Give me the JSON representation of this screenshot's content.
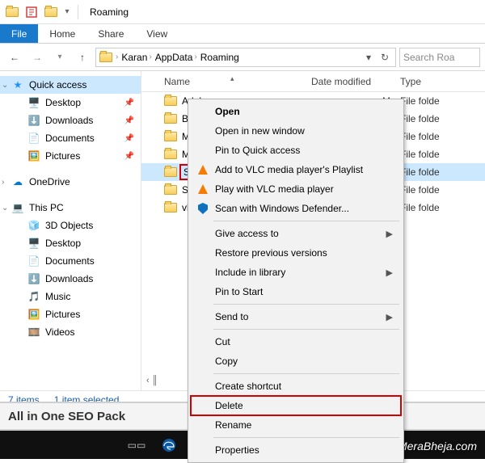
{
  "window": {
    "title": "Roaming"
  },
  "ribbon": {
    "file": "File",
    "home": "Home",
    "share": "Share",
    "view": "View"
  },
  "breadcrumb": {
    "items": [
      "Karan",
      "AppData",
      "Roaming"
    ]
  },
  "search": {
    "placeholder": "Search Roa"
  },
  "columns": {
    "name": "Name",
    "date": "Date modified",
    "type": "Type"
  },
  "navpane": {
    "quick_access": "Quick access",
    "quick_items": [
      {
        "label": "Desktop"
      },
      {
        "label": "Downloads"
      },
      {
        "label": "Documents"
      },
      {
        "label": "Pictures"
      }
    ],
    "onedrive": "OneDrive",
    "this_pc": "This PC",
    "pc_items": [
      {
        "label": "3D Objects"
      },
      {
        "label": "Desktop"
      },
      {
        "label": "Documents"
      },
      {
        "label": "Downloads"
      },
      {
        "label": "Music"
      },
      {
        "label": "Pictures"
      },
      {
        "label": "Videos"
      }
    ]
  },
  "files": [
    {
      "name": "Adobe",
      "date": "M",
      "type": "File folde"
    },
    {
      "name": "BID",
      "date": "M",
      "type": "File folde"
    },
    {
      "name": "Microso",
      "date": "M",
      "type": "File folde"
    },
    {
      "name": "Mozilla",
      "date": "PM",
      "type": "File folde"
    },
    {
      "name": "Skype",
      "date": "M",
      "type": "File folde",
      "selected": true
    },
    {
      "name": "Spotify",
      "date": "M",
      "type": "File folde"
    },
    {
      "name": "vlc",
      "date": "M",
      "type": "File folde"
    }
  ],
  "status": {
    "items": "7 items",
    "selected": "1 item selected"
  },
  "context_menu": {
    "open": "Open",
    "open_new": "Open in new window",
    "pin_quick": "Pin to Quick access",
    "vlc_add": "Add to VLC media player's Playlist",
    "vlc_play": "Play with VLC media player",
    "defender": "Scan with Windows Defender...",
    "give_access": "Give access to",
    "restore": "Restore previous versions",
    "include_lib": "Include in library",
    "pin_start": "Pin to Start",
    "send_to": "Send to",
    "cut": "Cut",
    "copy": "Copy",
    "shortcut": "Create shortcut",
    "delete": "Delete",
    "rename": "Rename",
    "properties": "Properties"
  },
  "seo": {
    "label": "All in One SEO Pack"
  },
  "watermark": "MeraBheja.com"
}
